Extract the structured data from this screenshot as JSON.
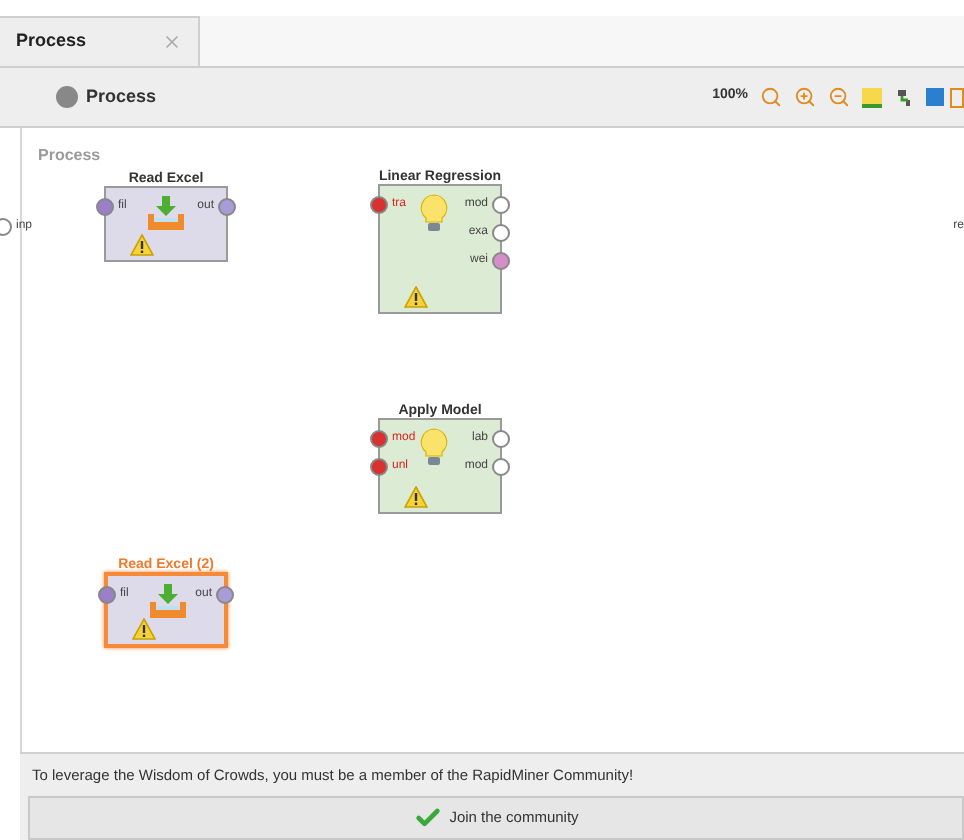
{
  "tabs": [
    {
      "label": "Process",
      "selected": true
    }
  ],
  "toolbar": {
    "breadcrumb": "Process",
    "zoom": "100%"
  },
  "canvas": {
    "label": "Process",
    "process_inputs": [
      "inp"
    ],
    "process_outputs": [
      "re"
    ],
    "operators": [
      {
        "name": "Read Excel",
        "kind": "excel",
        "selected": false,
        "warning": true,
        "inputs": [
          {
            "label": "fil",
            "error": false,
            "color": "#9b7fc7"
          }
        ],
        "outputs": [
          {
            "label": "out",
            "error": false,
            "color": "#a99ad8"
          }
        ]
      },
      {
        "name": "Linear Regression",
        "kind": "bulb",
        "selected": false,
        "warning": true,
        "inputs": [
          {
            "label": "tra",
            "error": true,
            "color": "#d93030"
          }
        ],
        "outputs": [
          {
            "label": "mod",
            "error": false,
            "color": "#ffffff"
          },
          {
            "label": "exa",
            "error": false,
            "color": "#ffffff"
          },
          {
            "label": "wei",
            "error": false,
            "color": "#d58fc8"
          }
        ]
      },
      {
        "name": "Apply Model",
        "kind": "bulb",
        "selected": false,
        "warning": true,
        "inputs": [
          {
            "label": "mod",
            "error": true,
            "color": "#d93030"
          },
          {
            "label": "unl",
            "error": true,
            "color": "#d93030"
          }
        ],
        "outputs": [
          {
            "label": "lab",
            "error": false,
            "color": "#ffffff"
          },
          {
            "label": "mod",
            "error": false,
            "color": "#ffffff"
          }
        ]
      },
      {
        "name": "Read Excel (2)",
        "kind": "excel",
        "selected": true,
        "warning": true,
        "inputs": [
          {
            "label": "fil",
            "error": false,
            "color": "#9b7fc7"
          }
        ],
        "outputs": [
          {
            "label": "out",
            "error": false,
            "color": "#a99ad8"
          }
        ]
      }
    ]
  },
  "message": "To leverage the Wisdom of Crowds, you must be a member of the RapidMiner Community!",
  "join_button": "Join the community"
}
